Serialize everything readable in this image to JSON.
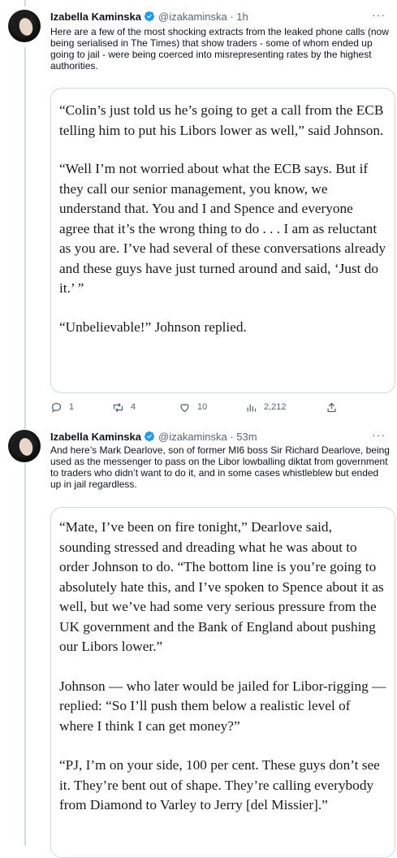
{
  "tweets": [
    {
      "author": "Izabella Kaminska",
      "handle": "@izakaminska",
      "time": "1h",
      "text": "Here are a few of the most shocking extracts from the leaked phone calls (now being serialised in The Times) that show traders - some of whom ended up going to jail - were being coerced into misrepresenting rates by the highest authorities.",
      "quote_paragraphs": [
        "“Colin’s just told us he’s going to get a call from the ECB telling him to put his Libors lower as well,” said Johnson.",
        "“Well I’m not worried about what the ECB says. But if they call our senior management, you know, we understand that. You and I and Spence and everyone agree that it’s the wrong thing to do . . . I am as reluctant as you are. I’ve had several of these conversations already and these guys have just turned around and said, ‘Just do it.’ ”",
        "“Unbelievable!” Johnson replied."
      ],
      "replies": "1",
      "retweets": "4",
      "likes": "10",
      "views": "2,212"
    },
    {
      "author": "Izabella Kaminska",
      "handle": "@izakaminska",
      "time": "53m",
      "text": "And here’s Mark Dearlove, son of former MI6 boss Sir Richard Dearlove, being used as the messenger to pass on the Libor lowballing diktat from government to traders who didn’t want to do it, and in some cases whistleblew but ended up in jail regardless.",
      "quote_paragraphs": [
        "“Mate, I’ve been on fire tonight,” Dearlove said, sounding stressed and dreading what he was about to order Johnson to do. “The bottom line is you’re going to absolutely hate this, and I’ve spoken to Spence about it as well, but we’ve had some very serious pressure from the UK government and the Bank of England about pushing our Libors lower.”",
        "Johnson — who later would be jailed for Libor-rigging — replied: “So I’ll push them below a realistic level of where I think I can get money?”",
        "“PJ, I’m on your side, 100 per cent. These guys don’t see it. They’re bent out of shape. They’re calling everybody from Diamond to Varley to Jerry [del Missier].”"
      ]
    }
  ],
  "colors": {
    "verified": "#1d9bf0",
    "secondary_text": "#536471",
    "border": "#cfd9de"
  },
  "icons": {
    "reply": "reply-icon",
    "retweet": "retweet-icon",
    "like": "heart-icon",
    "views": "views-icon",
    "share": "share-icon",
    "more": "more-icon"
  }
}
